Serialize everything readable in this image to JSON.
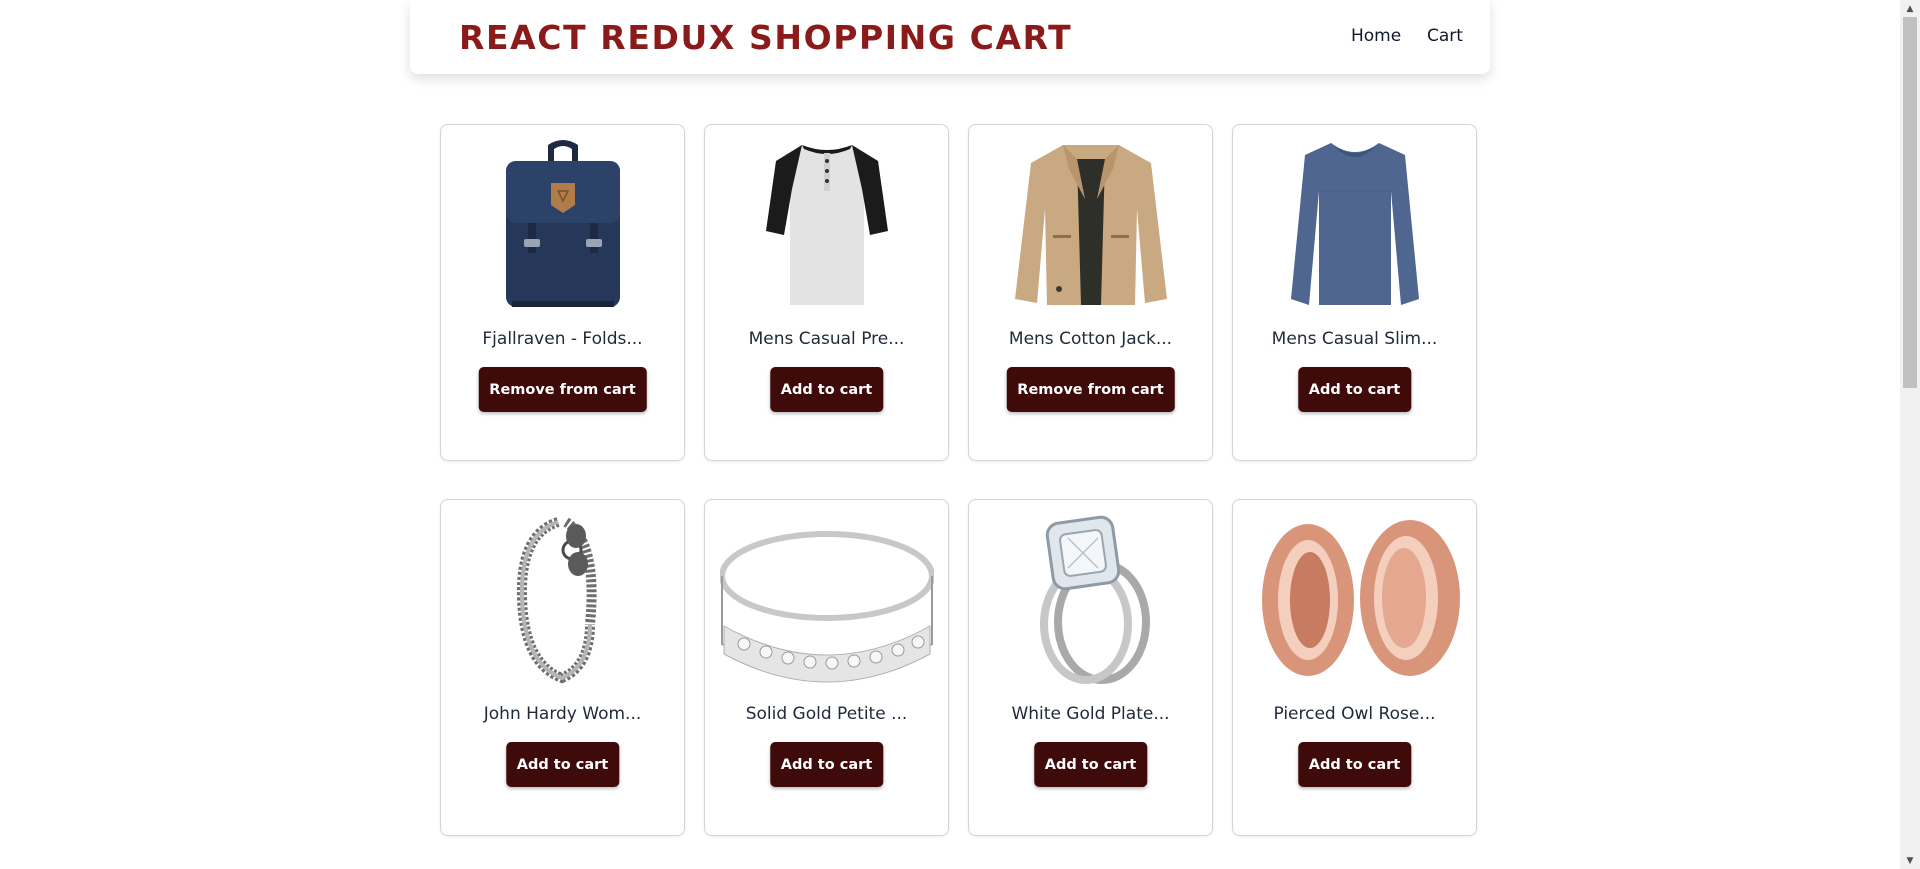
{
  "header": {
    "brand": "REACT REDUX SHOPPING CART",
    "nav": {
      "home": "Home",
      "cart": "Cart"
    }
  },
  "products": [
    {
      "title": "Fjallraven - Folds...",
      "button": "Remove from cart",
      "icon": "backpack-image"
    },
    {
      "title": "Mens Casual Pre...",
      "button": "Add to cart",
      "icon": "henley-shirt-image"
    },
    {
      "title": "Mens Cotton Jack...",
      "button": "Remove from cart",
      "icon": "cotton-jacket-image"
    },
    {
      "title": "Mens Casual Slim...",
      "button": "Add to cart",
      "icon": "slim-fit-shirt-image"
    },
    {
      "title": "John Hardy Wom...",
      "button": "Add to cart",
      "icon": "chain-bracelet-image"
    },
    {
      "title": "Solid Gold Petite ...",
      "button": "Add to cart",
      "icon": "gold-micropave-bangle-image"
    },
    {
      "title": "White Gold Plate...",
      "button": "Add to cart",
      "icon": "princess-ring-image"
    },
    {
      "title": "Pierced Owl Rose...",
      "button": "Add to cart",
      "icon": "rose-gold-plugs-image"
    }
  ],
  "colors": {
    "brand": "#8b1a1a",
    "button_bg": "#3f0a0a",
    "button_text": "#ffffff"
  }
}
